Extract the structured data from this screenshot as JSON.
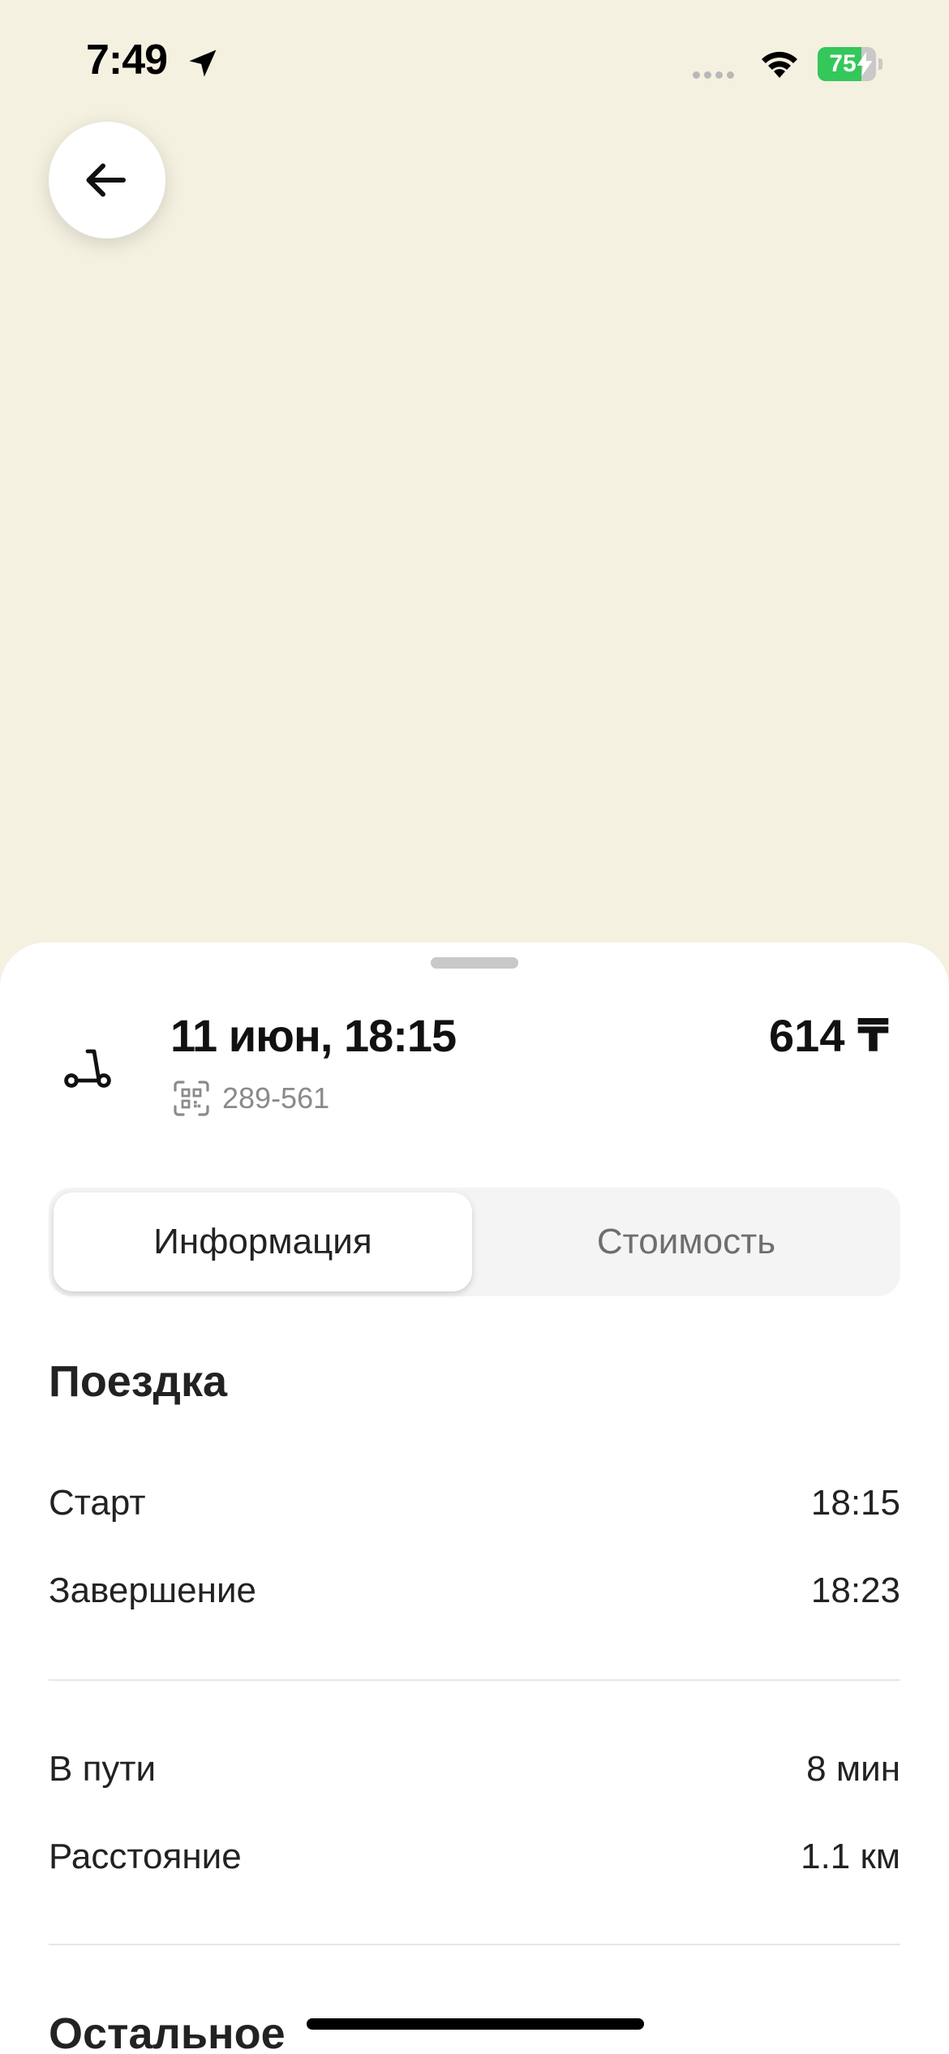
{
  "status_bar": {
    "time": "7:49",
    "battery_level": "75",
    "battery_fraction": 0.75,
    "battery_color": "#34c759",
    "icons": [
      "location-arrow-icon",
      "cellular-signal-icon",
      "wifi-icon",
      "battery-icon"
    ]
  },
  "nav": {
    "back_icon": "arrow-left-icon"
  },
  "ride": {
    "date": "11 июн, 18:15",
    "vehicle_id": "289-561",
    "price": "614 ₸",
    "vehicle_icon": "scooter-icon",
    "id_icon": "qr-code-icon"
  },
  "tabs": [
    {
      "label": "Информация",
      "active": true
    },
    {
      "label": "Стоимость",
      "active": false
    }
  ],
  "trip_section": {
    "title": "Поездка",
    "rows": [
      {
        "label": "Старт",
        "value": "18:15"
      },
      {
        "label": "Завершение",
        "value": "18:23"
      },
      {
        "label": "В пути",
        "value": "8 мин"
      },
      {
        "label": "Расстояние",
        "value": "1.1 км"
      }
    ]
  },
  "other_section": {
    "title": "Остальное"
  },
  "colors": {
    "map_background": "#f4f1e1",
    "sheet_background": "#ffffff",
    "text_primary": "#111111",
    "text_secondary": "#8a8a8a"
  }
}
